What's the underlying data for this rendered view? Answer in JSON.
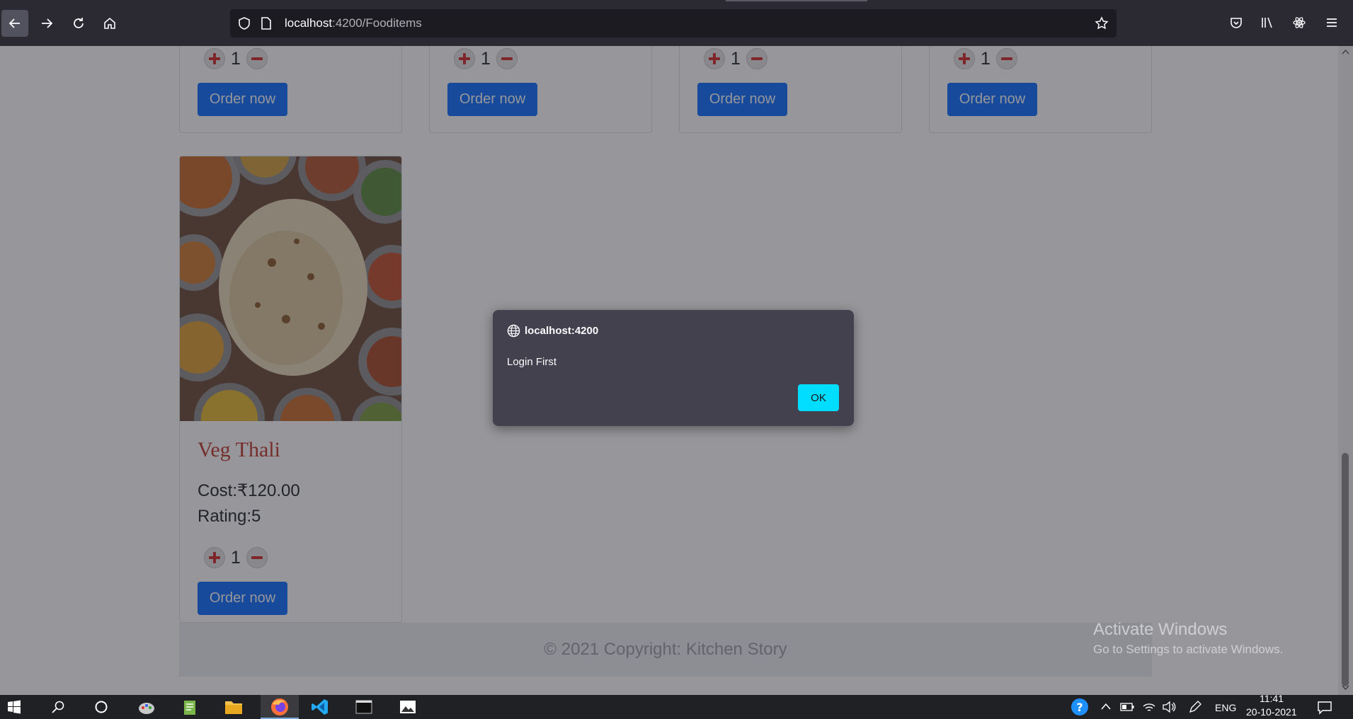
{
  "browser": {
    "url_host": "localhost",
    "url_path": ":4200/Fooditems"
  },
  "food_cards": [
    {
      "quantity": "1",
      "order_label": "Order now"
    },
    {
      "quantity": "1",
      "order_label": "Order now"
    },
    {
      "quantity": "1",
      "order_label": "Order now"
    },
    {
      "quantity": "1",
      "order_label": "Order now"
    },
    {
      "name": "Veg Thali",
      "cost": "Cost:₹120.00",
      "rating": "Rating:5",
      "quantity": "1",
      "order_label": "Order now"
    }
  ],
  "footer": {
    "text": "© 2021 Copyright: Kitchen Story"
  },
  "dialog": {
    "host": "localhost:4200",
    "message": "Login First",
    "ok_label": "OK"
  },
  "watermark": {
    "title": "Activate Windows",
    "subtitle": "Go to Settings to activate Windows."
  },
  "taskbar": {
    "language": "ENG",
    "time": "11:41",
    "date": "20-10-2021"
  },
  "colors": {
    "order_button": "#0d6efd",
    "dialog_bg": "#42414d",
    "ok_button": "#00ddff",
    "food_name": "#c0392b"
  }
}
